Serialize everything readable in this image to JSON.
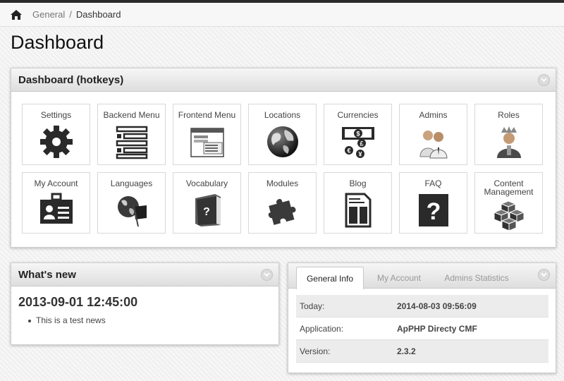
{
  "breadcrumb": {
    "items": [
      "General"
    ],
    "separator": "/",
    "current": "Dashboard"
  },
  "page": {
    "title": "Dashboard"
  },
  "hotkeys": {
    "title": "Dashboard (hotkeys)",
    "items": [
      {
        "label": "Settings",
        "icon": "gear-icon"
      },
      {
        "label": "Backend Menu",
        "icon": "backend-menu-icon"
      },
      {
        "label": "Frontend Menu",
        "icon": "frontend-menu-icon"
      },
      {
        "label": "Locations",
        "icon": "globe-icon"
      },
      {
        "label": "Currencies",
        "icon": "currencies-icon"
      },
      {
        "label": "Admins",
        "icon": "admins-icon"
      },
      {
        "label": "Roles",
        "icon": "roles-icon"
      },
      {
        "label": "My Account",
        "icon": "id-card-icon"
      },
      {
        "label": "Languages",
        "icon": "languages-icon"
      },
      {
        "label": "Vocabulary",
        "icon": "vocabulary-book-icon"
      },
      {
        "label": "Modules",
        "icon": "puzzle-icon"
      },
      {
        "label": "Blog",
        "icon": "blog-icon"
      },
      {
        "label": "FAQ",
        "icon": "faq-icon"
      },
      {
        "label": "Content Management",
        "icon": "cubes-icon"
      }
    ]
  },
  "whats_new": {
    "title": "What's new",
    "date": "2013-09-01 12:45:00",
    "items": [
      "This is a test news"
    ]
  },
  "info": {
    "tabs": [
      "General Info",
      "My Account",
      "Admins Statistics"
    ],
    "active_tab": "General Info",
    "rows": [
      {
        "key": "Today:",
        "value": "2014-08-03 09:56:09"
      },
      {
        "key": "Application:",
        "value": "ApPHP Directy CMF"
      },
      {
        "key": "Version:",
        "value": "2.3.2"
      }
    ]
  },
  "colors": {
    "topbar": "#2b2b2b",
    "icon_dark": "#2a2a2a",
    "panel_header": "#dedede"
  }
}
